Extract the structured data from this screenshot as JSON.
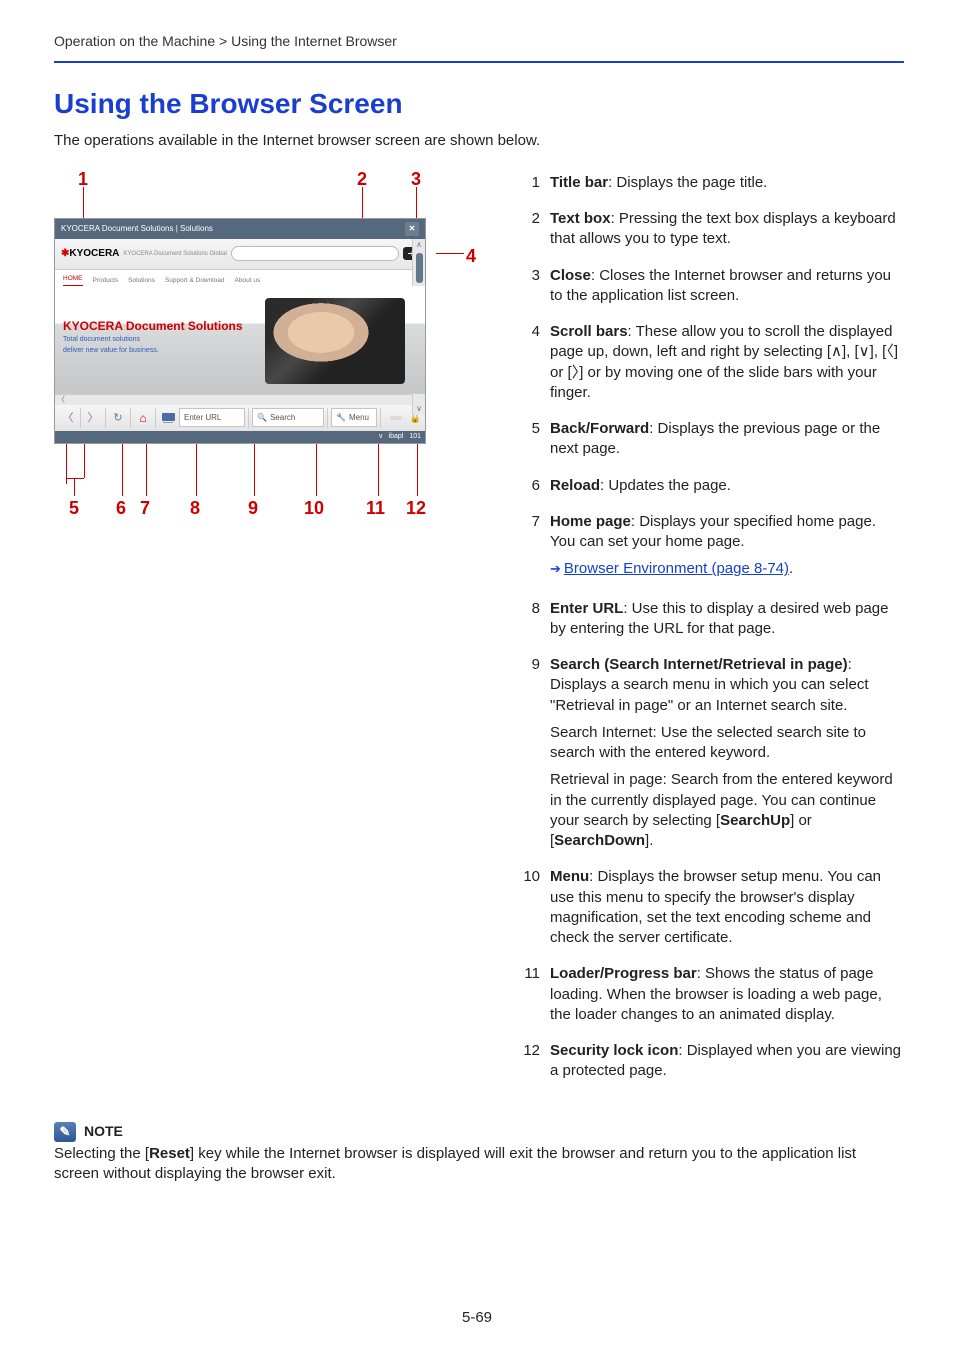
{
  "breadcrumb": {
    "section": "Operation on the Machine",
    "sep": " > ",
    "sub": "Using the Internet Browser"
  },
  "heading": "Using the Browser Screen",
  "intro": "The operations available in the Internet browser screen are shown below.",
  "diagram": {
    "title_bar_text": "KYOCERA Document Solutions | Solutions",
    "logo_prefix": "K",
    "logo_text": "KYOCERA",
    "logo_note": "KYOCERA Document Solutions  Global",
    "tabs": [
      "HOME",
      "Products",
      "Solutions",
      "Support & Download",
      "About us"
    ],
    "content_headline": "KYOCERA Document Solutions",
    "content_sub1": "Total document solutions",
    "content_sub2": "deliver new value for business.",
    "enter_url": "Enter URL",
    "search": "Search",
    "menu": "Menu",
    "status_left": "v",
    "status_right": "ibapl",
    "status_num": "101",
    "callouts_top": [
      "1",
      "2",
      "3"
    ],
    "callout_right": "4",
    "callouts_bottom": [
      "5",
      "6",
      "7",
      "8",
      "9",
      "10",
      "11",
      "12"
    ]
  },
  "items": [
    {
      "n": "1",
      "label": "Title bar",
      "text": ": Displays the page title."
    },
    {
      "n": "2",
      "label": "Text box",
      "text": ": Pressing the text box displays a keyboard that allows you to type text."
    },
    {
      "n": "3",
      "label": "Close",
      "text": ": Closes the Internet browser and returns you to the application list screen."
    },
    {
      "n": "4",
      "label": "Scroll bars",
      "text_parts": [
        ": These allow you to scroll the displayed page up, down, left and right by selecting [",
        "], [",
        "], [",
        "] or [",
        "] or by moving one of the slide bars with your finger."
      ],
      "icons": [
        "chevron-up-icon",
        "chevron-down-icon",
        "chevron-left-icon",
        "chevron-right-icon"
      ]
    },
    {
      "n": "5",
      "label": "Back/Forward",
      "text": ": Displays the previous page or the next page."
    },
    {
      "n": "6",
      "label": "Reload",
      "text": ": Updates the page."
    },
    {
      "n": "7",
      "label": "Home page",
      "text": ": Displays your specified home page. You can set your home page.",
      "link": "Browser Environment (page 8-74)"
    },
    {
      "n": "8",
      "label": "Enter URL",
      "text": ": Use this to display a desired web page by entering the URL for that page."
    },
    {
      "n": "9",
      "label": "Search (Search Internet/Retrieval in page)",
      "para1": ": Displays a search menu in which you can select \"Retrieval in page\" or an Internet search site.",
      "para2": "Search Internet: Use the selected search site to search with the entered keyword.",
      "para3a": "Retrieval in page: Search from the entered keyword in the currently displayed page. You can continue your search by selecting [",
      "para3_bold1": "SearchUp",
      "para3b": "] or [",
      "para3_bold2": "SearchDown",
      "para3c": "]."
    },
    {
      "n": "10",
      "label": "Menu",
      "text": ": Displays the browser setup menu. You can use this menu to specify the browser's display magnification, set the text encoding scheme and check the server certificate."
    },
    {
      "n": "11",
      "label": "Loader/Progress bar",
      "text": ": Shows the status of page loading. When the browser is loading a web page, the loader changes to an animated display."
    },
    {
      "n": "12",
      "label": "Security lock icon",
      "text": ": Displayed when you are viewing a protected page."
    }
  ],
  "link_text": ".",
  "note": {
    "title": "NOTE",
    "pre": "Selecting the [",
    "bold": "Reset",
    "post": "] key while the Internet browser is displayed will exit the browser and return you to the application list screen without displaying the browser exit."
  },
  "page_num": "5-69"
}
